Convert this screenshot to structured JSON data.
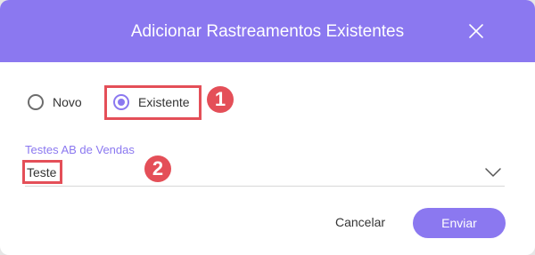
{
  "dialog": {
    "title": "Adicionar Rastreamentos Existentes",
    "close_icon": "close-icon"
  },
  "radio_options": [
    {
      "label": "Novo",
      "selected": false
    },
    {
      "label": "Existente",
      "selected": true
    }
  ],
  "annotations": [
    "1",
    "2"
  ],
  "field": {
    "label": "Testes AB de Vendas",
    "value": "Teste",
    "icon": "chevron-down-icon"
  },
  "buttons": {
    "cancel": "Cancelar",
    "submit": "Enviar"
  },
  "colors": {
    "accent": "#8b78f0",
    "annotation": "#e44f58"
  }
}
